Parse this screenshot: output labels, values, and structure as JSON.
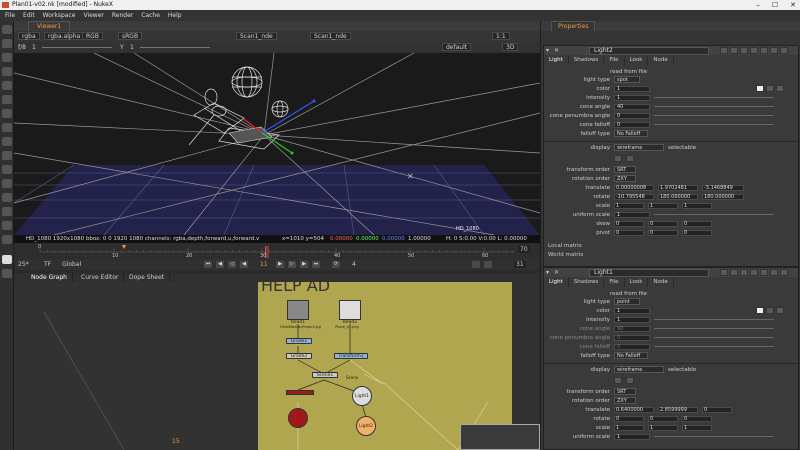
{
  "window": {
    "title": "Plan01-v02.nk [modified] - NukeX",
    "min": "–",
    "max": "☐",
    "close": "✕"
  },
  "menu": [
    "File",
    "Edit",
    "Workspace",
    "Viewer",
    "Render",
    "Cache",
    "Help"
  ],
  "viewer": {
    "tab_label": "Viewer1",
    "channels": "rgba",
    "layer": "rgba.alpha",
    "colorspace": "RGB",
    "lut": "sRGB",
    "camera": "Scan1_nde",
    "scan_node": "Scan1_nde",
    "gain_label": "f/8",
    "gain_value": "1",
    "gamma_label": "Y",
    "gamma_value": "1",
    "zoom": "1:1",
    "view_mode": "3D",
    "display": "default",
    "info_left": "HD_1080 1920x1080  bbox: 0 0 1920 1080 channels: rgba,depth,forward,u,forward.v",
    "info_coords": "x=1010 y=504",
    "info_values": [
      "0.00000",
      "0.00000",
      "0.00000",
      "1.00000"
    ],
    "info_hsv": "H: 0 S:0.00 V:0.00  L: 0.00000",
    "format_label": "HD_1080"
  },
  "timeline": {
    "ticks": [
      "0",
      "10",
      "20",
      "30",
      "40",
      "50",
      "60",
      "70"
    ],
    "current_frame": "11",
    "fps": "25*",
    "tf": "TF",
    "mode": "Global",
    "step": "4",
    "end_frame": "31",
    "start_frame": "1"
  },
  "nodegraph": {
    "tabs": [
      "Node Graph",
      "Curve Editor",
      "Dope Sheet"
    ],
    "backdrop_title": "HELP AD",
    "frame_marker": "15",
    "nodes": {
      "read1": "Read1",
      "read1_sub": "HelloMonkeyProject.jpg",
      "read2": "Read2",
      "read2_sub": "Plane_v1.png",
      "grade1": "Grade1",
      "grade2": "Grade2",
      "transform": "Transform1",
      "scene": "Scene1",
      "light1": "Light1",
      "light2": "Light2",
      "label_small": "Scene"
    }
  },
  "properties": {
    "tab_label": "Properties",
    "panels": [
      {
        "name": "Light2",
        "tabs": [
          "Light",
          "Shadows",
          "File",
          "Look",
          "Node"
        ],
        "read_from_file": "read from file",
        "light_type_label": "light type",
        "light_type": "spot",
        "color_label": "color",
        "color_value": "1",
        "intensity_label": "intensity",
        "intensity_value": "1",
        "cone_angle_label": "cone angle",
        "cone_angle_value": "40",
        "cone_penumbra_label": "cone penumbra angle",
        "cone_penumbra_value": "0",
        "cone_falloff_label": "cone falloff",
        "cone_falloff_value": "0",
        "falloff_type_label": "falloff type",
        "falloff_type": "No Falloff",
        "display_label": "display",
        "display_value": "wireframe",
        "selectable": "selectable",
        "transform_order_label": "transform order",
        "transform_order": "SRT",
        "rotation_order_label": "rotation order",
        "rotation_order": "ZXY",
        "translate_label": "translate",
        "translate": [
          "0.00000008",
          "1.9702481",
          "-3.1468849"
        ],
        "rotate_label": "rotate",
        "rotate": [
          "-10.795548",
          "180.000000",
          "180.000000"
        ],
        "scale_label": "scale",
        "scale": [
          "1",
          "1",
          "1"
        ],
        "uniform_scale_label": "uniform scale",
        "uniform_scale": "1",
        "skew_label": "skew",
        "skew": [
          "0",
          "0",
          "0"
        ],
        "pivot_label": "pivot",
        "pivot": [
          "0",
          "0",
          "0"
        ],
        "local_matrix": "Local matrix",
        "world_matrix": "World matrix"
      },
      {
        "name": "Light1",
        "tabs": [
          "Light",
          "Shadows",
          "File",
          "Look",
          "Node"
        ],
        "read_from_file": "read from file",
        "light_type_label": "light type",
        "light_type": "point",
        "color_label": "color",
        "color_value": "1",
        "intensity_label": "intensity",
        "intensity_value": "1",
        "cone_angle_label": "cone angle",
        "cone_angle_value": "90",
        "cone_penumbra_label": "cone penumbra angle",
        "cone_penumbra_value": "0",
        "cone_falloff_label": "cone falloff",
        "cone_falloff_value": "0",
        "falloff_type_label": "falloff type",
        "falloff_type": "No Falloff",
        "display_label": "display",
        "display_value": "wireframe",
        "selectable": "selectable",
        "transform_order_label": "transform order",
        "transform_order": "SRT",
        "rotation_order_label": "rotation order",
        "rotation_order": "ZXY",
        "translate_label": "translate",
        "translate": [
          "0.6400000",
          "2.8599999",
          "0"
        ],
        "rotate_label": "rotate",
        "rotate": [
          "0",
          "0",
          "0"
        ],
        "scale_label": "scale",
        "scale": [
          "1",
          "1",
          "1"
        ],
        "uniform_scale_label": "uniform scale",
        "uniform_scale": "1"
      }
    ]
  },
  "colors": {
    "accent": "#f39a3b",
    "backdrop": "#b0a650",
    "grid": "#6a6aa8",
    "light_node": "#dcdcdc",
    "light2_node": "#f2b06a",
    "red_node": "#a01818"
  }
}
